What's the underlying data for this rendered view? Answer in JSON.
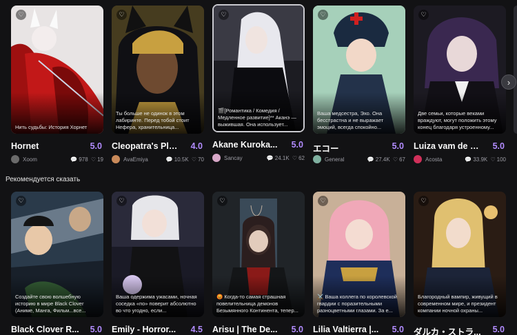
{
  "colors": {
    "background": "#121214",
    "rating": "#b28cff",
    "meta": "#9b9ba3"
  },
  "section": {
    "recommended_title": "Рекомендуется сказать"
  },
  "row1": [
    {
      "title": "Hornet",
      "rating": "5.0",
      "author": "Xoom",
      "chats": "978",
      "likes": "19",
      "desc": "Нить судьбы: История Хорнет",
      "author_color": "#6b6b6b"
    },
    {
      "title": "Cleopatra's Pla...",
      "rating": "4.0",
      "author": "AvaEmiya",
      "chats": "10.5K",
      "likes": "70",
      "desc": "Ты больше не одинок в этом лабиринте. Перед тобой стоит Нефера, хранительница...",
      "author_color": "#c98a5a"
    },
    {
      "title": "Akane Kuroka...",
      "rating": "5.0",
      "author": "Sancay",
      "chats": "24.1K",
      "likes": "62",
      "desc": "🎬[Романтика / Комедия / Медленное развитие]** Аканэ — выжившая. Она использует...",
      "author_color": "#d8a8c8"
    },
    {
      "title": "エコー",
      "rating": "5.0",
      "author": "General",
      "chats": "27.4K",
      "likes": "67",
      "desc": "Ваша медсестра, Эхо. Она бесстрастна и не выражает эмоций, всегда спокойно...",
      "author_color": "#7fb0a0"
    },
    {
      "title": "Luiza vam de L...",
      "rating": "5.0",
      "author": "Acosta",
      "chats": "33.9K",
      "likes": "100",
      "desc": "Две семьи, которые веками враждуют, могут положить этому конец благодаря устроенному...",
      "author_color": "#d0305a"
    }
  ],
  "row2": [
    {
      "title": "Black Clover R...",
      "rating": "5.0",
      "desc": "Создайте свою волшебную историю в мире Black Clover (Аниме, Манга, Фильм...все..."
    },
    {
      "title": "Emily - Horror...",
      "rating": "4.5",
      "desc": "Ваша одержима ужасами, ночная соседка «по» поверит абсолютно во что угодно, если..."
    },
    {
      "title": "Arisu | The De...",
      "rating": "5.0",
      "desc": "😡 Когда-то самая страшная повелительница демонов Безымянного Континента, тепер..."
    },
    {
      "title": "Lilia Valtierra |...",
      "rating": "5.0",
      "desc": "⚔️ Ваша коллега по королевской гвардии с поразительными разноцветными глазами. За е..."
    },
    {
      "title": "ダルカ・ストラ...",
      "rating": "5.0",
      "desc": "Благородный вампир, живущий в современном мире, и президент компании ночной охраны..."
    }
  ],
  "icons": {
    "heart": "heart-icon",
    "chat": "chat-icon",
    "like": "like-icon",
    "next": "chevron-right-icon"
  }
}
